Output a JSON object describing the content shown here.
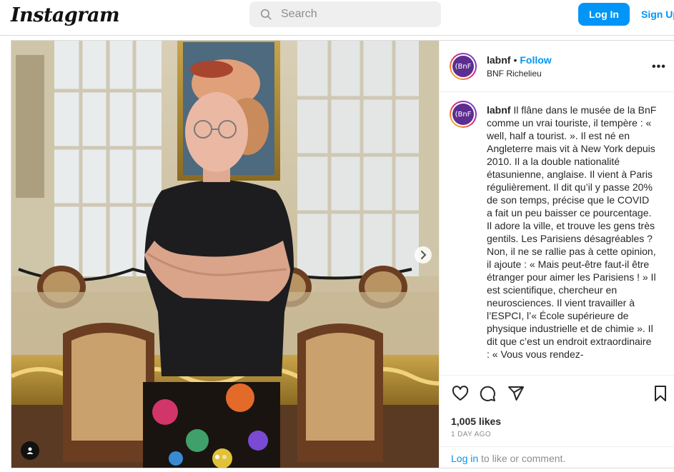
{
  "header": {
    "logo_text": "Instagram",
    "search_placeholder": "Search",
    "login_label": "Log In",
    "signup_label": "Sign Up"
  },
  "post": {
    "username": "labnf",
    "separator": "•",
    "follow_label": "Follow",
    "location": "BNF Richelieu",
    "avatar_text": "(BnF",
    "more_label": "•••",
    "caption_username": "labnf",
    "caption_text": "Il flâne dans le musée de la BnF comme un vrai touriste, il tempère : « well, half a tourist. ». Il est né en Angleterre mais vit à New York depuis 2010. Il a la double nationalité étasunienne, anglaise. Il vient à Paris régulièrement. Il dit qu’il y passe 20% de son temps, précise que le COVID a fait un peu baisser ce pourcentage. Il adore la ville, et trouve les gens très gentils. Les Parisiens désagréables ? Non, il ne se rallie pas à cette opinion, il ajoute : « Mais peut-être faut-il être étranger pour aimer les Parisiens ! » Il est scientifique, chercheur en neurosciences. Il vient travailler à l’ESPCI, l’« École supérieure de physique industrielle et de chimie ». Il dit que c’est un endroit extraordinaire : « Vous vous rendez-",
    "likes": "1,005 likes",
    "date": "1 DAY AGO",
    "comment_login": "Log in",
    "comment_rest": " to like or comment."
  },
  "icons": {
    "search": "search-icon",
    "like": "heart-icon",
    "comment": "comment-icon",
    "share": "share-icon",
    "save": "bookmark-icon",
    "next": "chevron-right-icon",
    "tag": "user-tag-icon"
  },
  "colors": {
    "accent": "#0095f6",
    "text": "#262626",
    "muted": "#8e8e8e",
    "border": "#dbdbdb"
  },
  "carousel": {
    "slide_count": 2,
    "active_slide": 1
  }
}
